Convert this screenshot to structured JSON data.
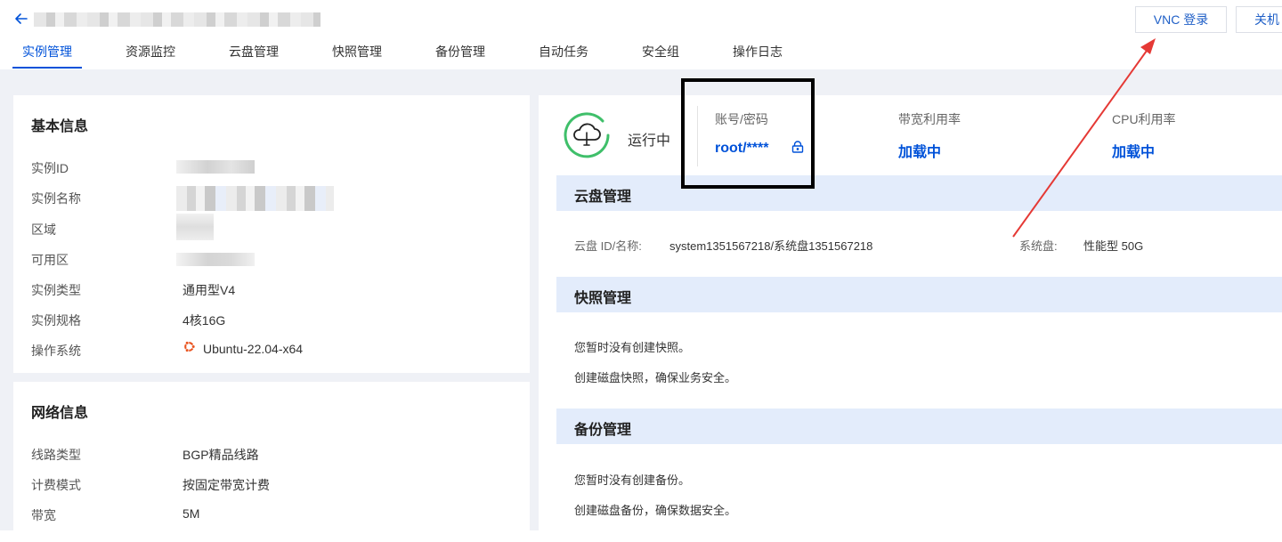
{
  "header": {
    "buttons": {
      "vnc": "VNC 登录",
      "shutdown": "关机"
    }
  },
  "tabs": [
    {
      "label": "实例管理",
      "active": true
    },
    {
      "label": "资源监控"
    },
    {
      "label": "云盘管理"
    },
    {
      "label": "快照管理"
    },
    {
      "label": "备份管理"
    },
    {
      "label": "自动任务"
    },
    {
      "label": "安全组"
    },
    {
      "label": "操作日志"
    }
  ],
  "basic_info": {
    "title": "基本信息",
    "rows": [
      {
        "label": "实例ID",
        "value": ""
      },
      {
        "label": "实例名称",
        "value": ""
      },
      {
        "label": "区域",
        "value": ""
      },
      {
        "label": "可用区",
        "value": ""
      },
      {
        "label": "实例类型",
        "value": "通用型V4"
      },
      {
        "label": "实例规格",
        "value": "4核16G"
      },
      {
        "label": "操作系统",
        "value": "Ubuntu-22.04-x64",
        "icon": "ubuntu-logo-icon"
      }
    ]
  },
  "network_info": {
    "title": "网络信息",
    "rows": [
      {
        "label": "线路类型",
        "value": "BGP精品线路"
      },
      {
        "label": "计费模式",
        "value": "按固定带宽计费"
      },
      {
        "label": "带宽",
        "value": "5M"
      }
    ]
  },
  "status": {
    "state": "运行中",
    "icon": "cloud-status-icon",
    "account": {
      "label": "账号/密码",
      "value": "root/****",
      "icon": "lock-icon"
    },
    "bandwidth": {
      "label": "带宽利用率",
      "value": "加载中"
    },
    "cpu": {
      "label": "CPU利用率",
      "value": "加载中"
    }
  },
  "disk": {
    "title": "云盘管理",
    "id_label": "云盘 ID/名称:",
    "id_value": "system1351567218/系统盘1351567218",
    "type_label": "系统盘:",
    "type_value": "性能型 50G"
  },
  "snapshot": {
    "title": "快照管理",
    "empty": "您暂时没有创建快照。",
    "hint": "创建磁盘快照，确保业务安全。"
  },
  "backup": {
    "title": "备份管理",
    "empty": "您暂时没有创建备份。",
    "hint": "创建磁盘备份，确保数据安全。"
  },
  "colors": {
    "accent": "#0052d9",
    "running": "#3fbf6a",
    "annotation": "#e53935"
  }
}
